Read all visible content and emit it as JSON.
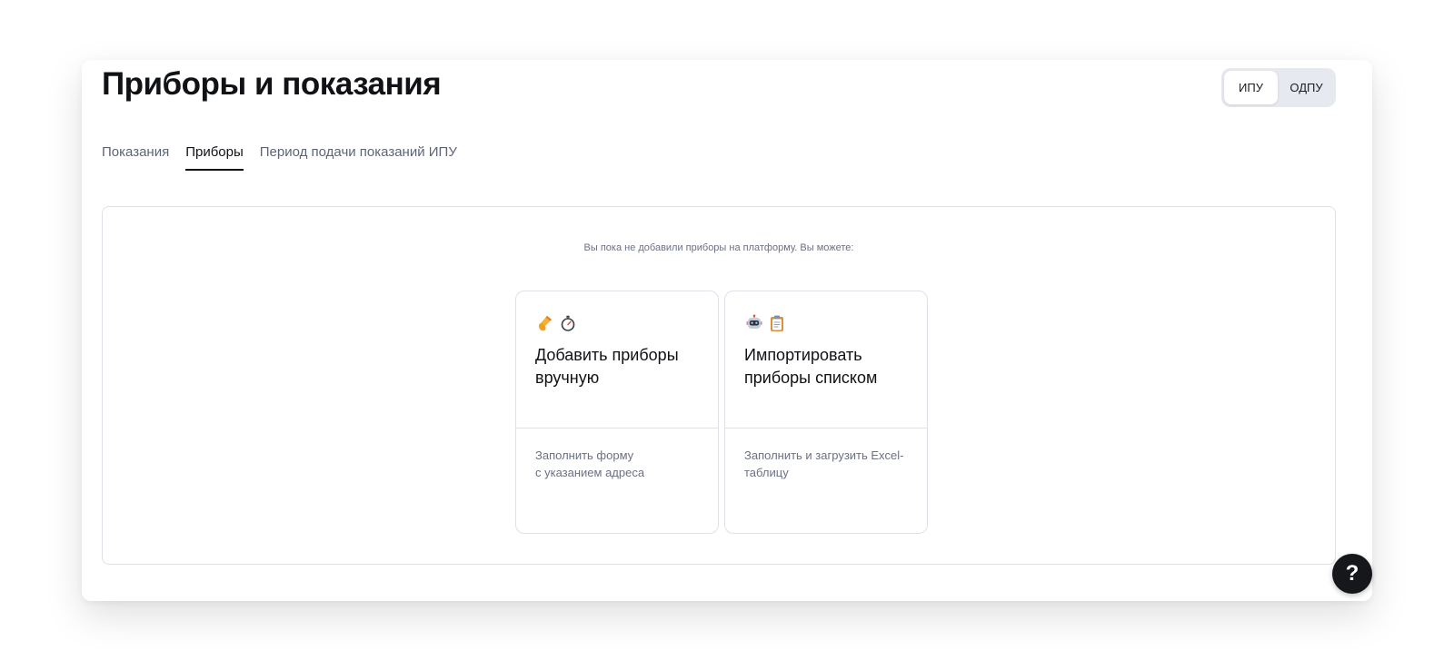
{
  "header": {
    "title": "Приборы и показания",
    "toggle": [
      {
        "label": "ИПУ",
        "active": true
      },
      {
        "label": "ОДПУ",
        "active": false
      }
    ]
  },
  "tabs": [
    {
      "label": "Показания",
      "active": false
    },
    {
      "label": "Приборы",
      "active": true
    },
    {
      "label": "Период подачи показаний ИПУ",
      "active": false
    }
  ],
  "main": {
    "empty_message": "Вы пока не добавили приборы на платформу. Вы можете:",
    "cards": [
      {
        "icons": [
          "writing-hand-icon",
          "stopwatch-icon"
        ],
        "title": "Добавить приборы вручную",
        "description": "Заполнить форму\nс указанием адреса"
      },
      {
        "icons": [
          "robot-icon",
          "clipboard-icon"
        ],
        "title": "Импортировать приборы списком",
        "description": "Заполнить и загрузить Excel-таблицу"
      }
    ]
  },
  "help": {
    "label": "?"
  }
}
